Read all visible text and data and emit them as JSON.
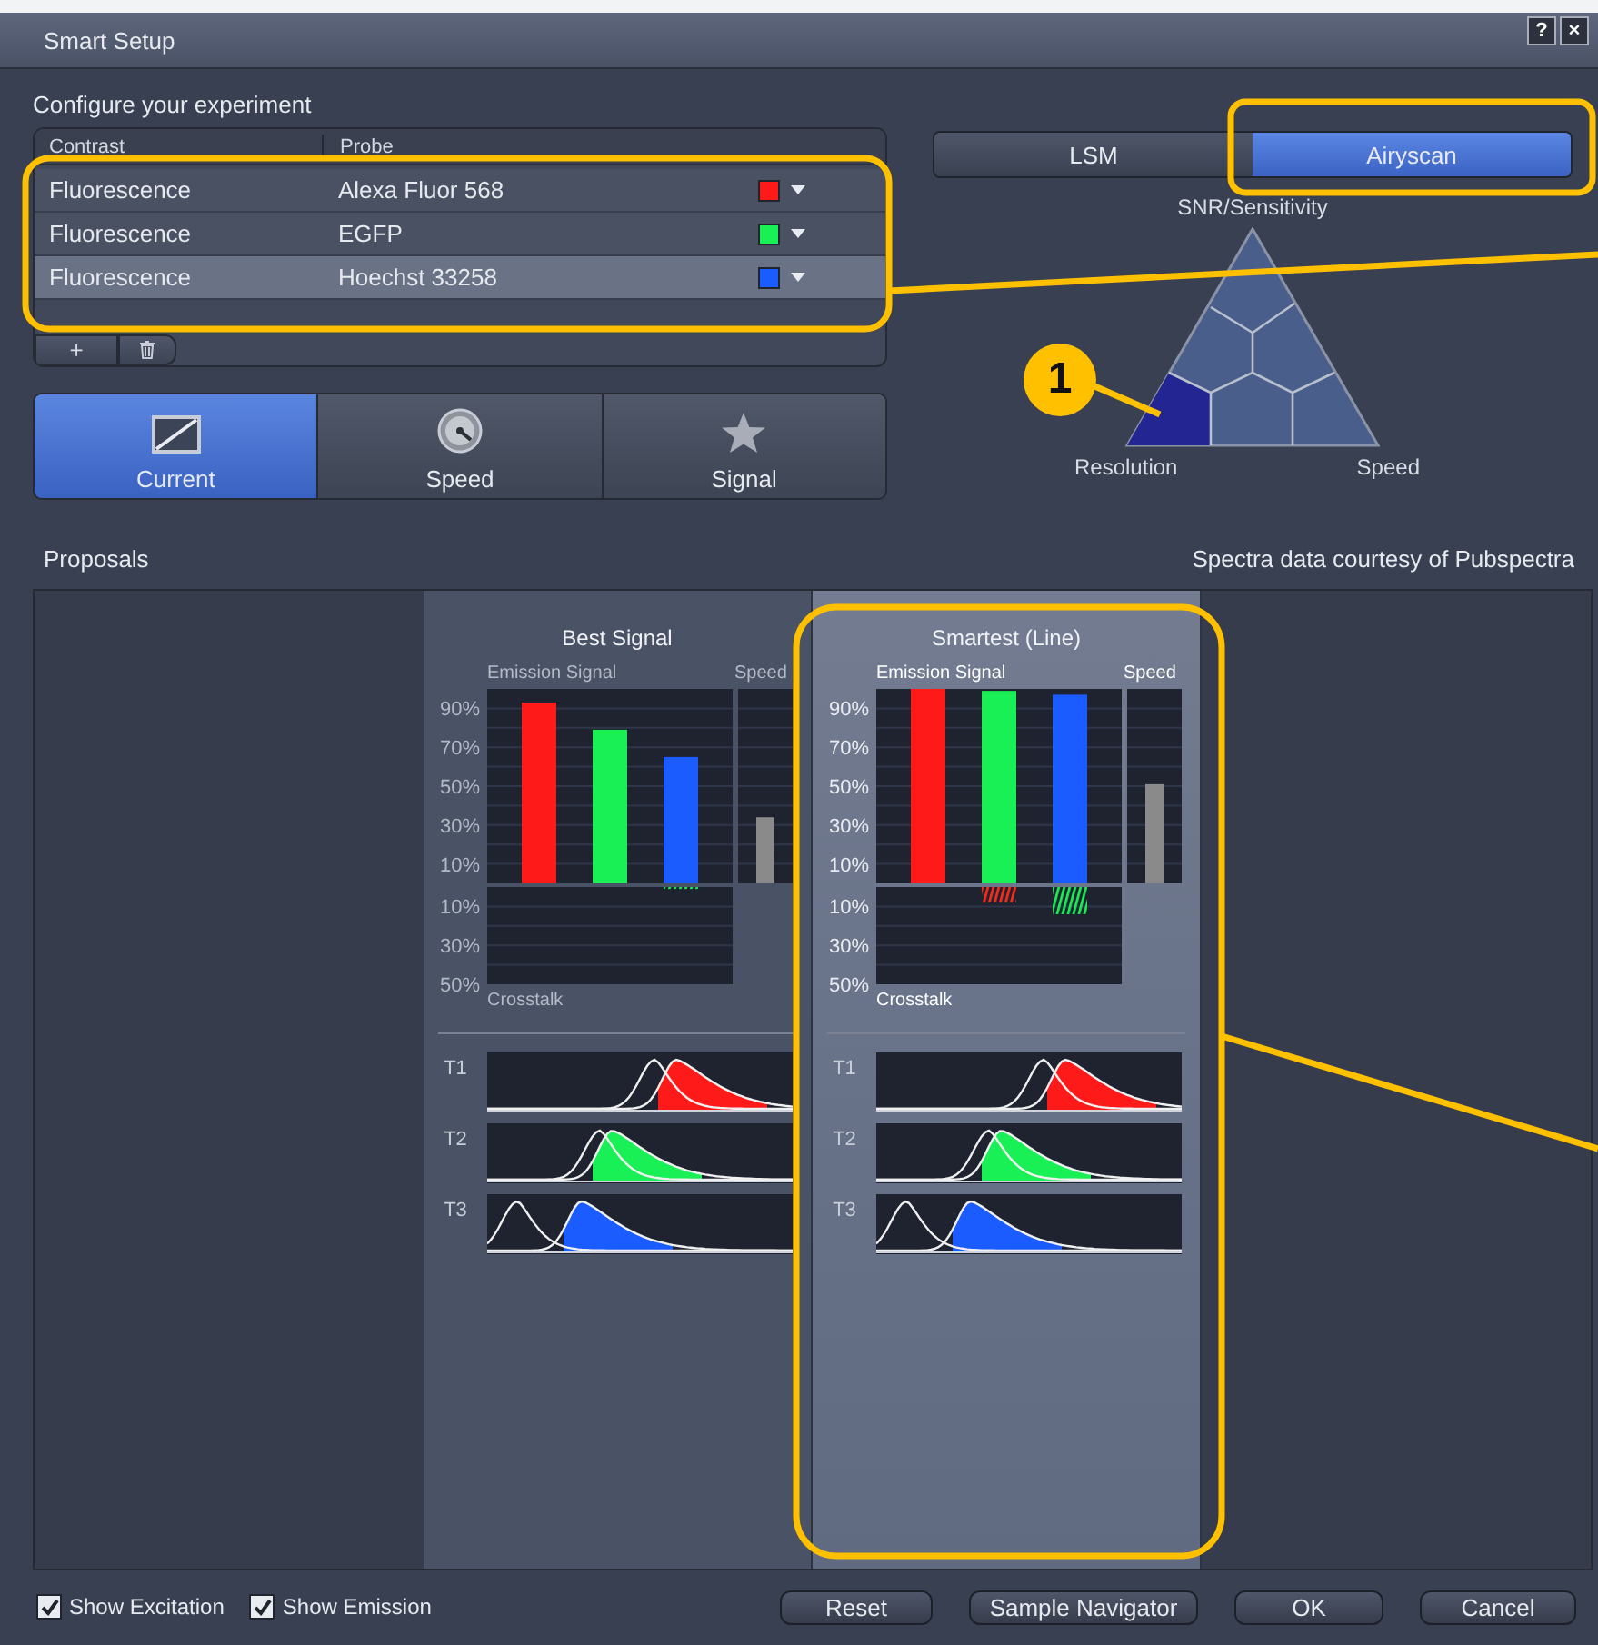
{
  "window": {
    "title": "Smart Setup",
    "buttons": [
      "?",
      "×"
    ]
  },
  "configure": {
    "heading": "Configure your experiment",
    "columns": [
      "Contrast",
      "Probe"
    ],
    "rows": [
      {
        "contrast": "Fluorescence",
        "probe": "Alexa Fluor 568",
        "color": "#ff1a1a",
        "selected": false
      },
      {
        "contrast": "Fluorescence",
        "probe": "EGFP",
        "color": "#19f055",
        "selected": false
      },
      {
        "contrast": "Fluorescence",
        "probe": "Hoechst 33258",
        "color": "#1a5cff",
        "selected": true
      }
    ],
    "add_button": "+"
  },
  "modes": [
    {
      "kind": "current",
      "label": "Current",
      "selected": true
    },
    {
      "kind": "speed",
      "label": "Speed",
      "selected": false
    },
    {
      "kind": "signal",
      "label": "Signal",
      "selected": false
    }
  ],
  "systems": [
    {
      "label": "LSM",
      "selected": false
    },
    {
      "label": "Airyscan",
      "selected": true
    }
  ],
  "triangle": {
    "top": "SNR/Sensitivity",
    "left": "Resolution",
    "right": "Speed"
  },
  "callout": {
    "label": "1"
  },
  "proposals": {
    "heading": "Proposals",
    "credit": "Spectra data courtesy of Pubspectra",
    "items": [
      {
        "title": "Best Signal",
        "selected": false,
        "emission": {
          "chart_data": {
            "type": "bar",
            "title": "Emission Signal",
            "grid": true,
            "ylim": [
              0,
              100
            ],
            "yticks": [
              {
                "value": 10,
                "label": "10%"
              },
              {
                "value": 30,
                "label": "30%"
              },
              {
                "value": 50,
                "label": "50%"
              },
              {
                "value": 70,
                "label": "70%"
              },
              {
                "value": 90,
                "label": "90%"
              }
            ],
            "values": [
              93,
              79,
              65
            ]
          }
        },
        "speed": {
          "title": "Speed",
          "level": 0.34
        },
        "crosstalk": {
          "chart_data": {
            "type": "bar",
            "title": "Crosstalk",
            "grid": true,
            "ylim": [
              50,
              0
            ],
            "yticks": [
              {
                "value": 10,
                "label": "10%"
              },
              {
                "value": 30,
                "label": "30%"
              },
              {
                "value": 50,
                "label": "50%"
              }
            ],
            "series": [
              {
                "color": "#19f055",
                "values": [
                  0,
                  0,
                  1
                ]
              }
            ]
          }
        },
        "tracks": [
          "T1",
          "T2",
          "T3"
        ]
      },
      {
        "title": "Smartest (Line)",
        "selected": true,
        "emission": {
          "chart_data": {
            "type": "bar",
            "title": "Emission Signal",
            "grid": true,
            "ylim": [
              0,
              100
            ],
            "yticks": [
              {
                "value": 10,
                "label": "10%"
              },
              {
                "value": 30,
                "label": "30%"
              },
              {
                "value": 50,
                "label": "50%"
              },
              {
                "value": 70,
                "label": "70%"
              },
              {
                "value": 90,
                "label": "90%"
              }
            ],
            "values": [
              100,
              99,
              97
            ]
          }
        },
        "speed": {
          "title": "Speed",
          "level": 0.51
        },
        "crosstalk": {
          "chart_data": {
            "type": "bar",
            "title": "Crosstalk",
            "grid": true,
            "ylim": [
              50,
              0
            ],
            "yticks": [
              {
                "value": 10,
                "label": "10%"
              },
              {
                "value": 30,
                "label": "30%"
              },
              {
                "value": 50,
                "label": "50%"
              }
            ],
            "series": [
              {
                "color": "#ff2a1a",
                "values": [
                  0,
                  8,
                  0
                ]
              },
              {
                "color": "#19f055",
                "values": [
                  0,
                  0,
                  14
                ]
              }
            ]
          }
        },
        "tracks": [
          "T1",
          "T2",
          "T3"
        ]
      }
    ]
  },
  "footer": {
    "checkboxes": [
      {
        "label": "Show Excitation",
        "checked": true
      },
      {
        "label": "Show Emission",
        "checked": true
      }
    ],
    "buttons": [
      "Reset",
      "Sample Navigator",
      "OK",
      "Cancel"
    ]
  }
}
